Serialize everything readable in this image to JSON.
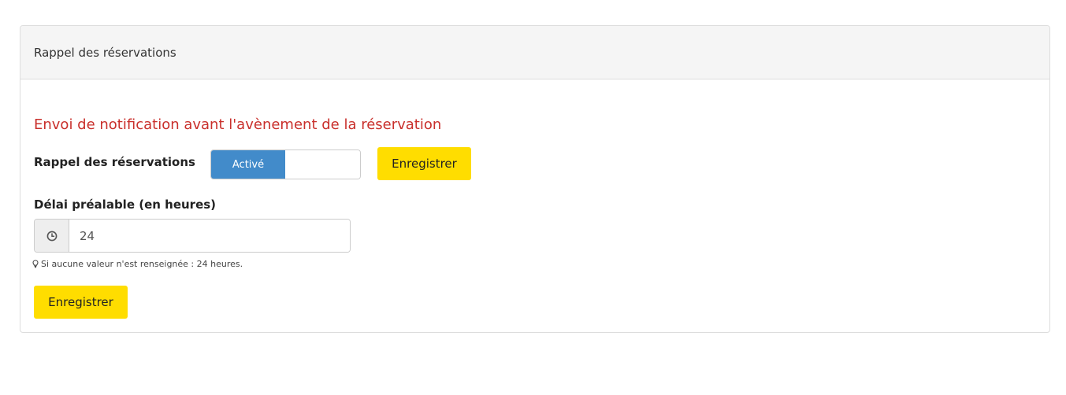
{
  "panel": {
    "heading": "Rappel des réservations"
  },
  "notification": {
    "section_title": "Envoi de notification avant l'avènement de la réservation",
    "toggle_label": "Rappel des réservations",
    "toggle_state": "Activé",
    "save_label": "Enregistrer"
  },
  "delay": {
    "label": "Délai préalable (en heures)",
    "value": "24",
    "addon_icon": "clock-icon",
    "help_icon": "lightbulb-icon",
    "help_text": "Si aucune valeur n'est renseignée : 24 heures.",
    "save_label": "Enregistrer"
  },
  "colors": {
    "title_red": "#c9302c",
    "toggle_blue": "#428bca",
    "button_yellow": "#ffdd00"
  }
}
